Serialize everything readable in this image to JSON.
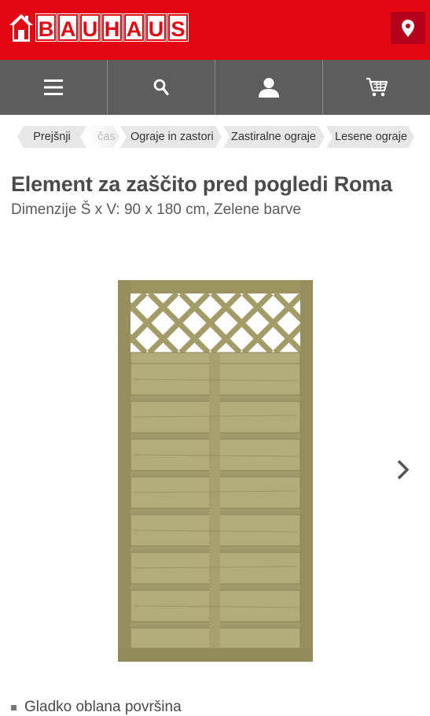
{
  "header": {
    "logo_text": "BAUHAUS",
    "brand_color": "#e30613",
    "location_icon": "map-pin-icon"
  },
  "nav": {
    "items": [
      {
        "icon": "hamburger-menu-icon"
      },
      {
        "icon": "search-icon"
      },
      {
        "icon": "user-icon"
      },
      {
        "icon": "cart-icon"
      }
    ],
    "bg_color": "#5d5d5d"
  },
  "breadcrumb": {
    "items": [
      "Prejšnji",
      "čas",
      "Ograje in zastori",
      "Zastiralne ograje",
      "Lesene ograje"
    ]
  },
  "product": {
    "title": "Element za zaščito pred pogledi Roma",
    "subtitle": "Dimenzije Š x V: 90 x 180 cm, Zelene barve",
    "image_alt": "wooden-fence-panel-image",
    "features": [
      "Gladko oblana površina"
    ]
  }
}
